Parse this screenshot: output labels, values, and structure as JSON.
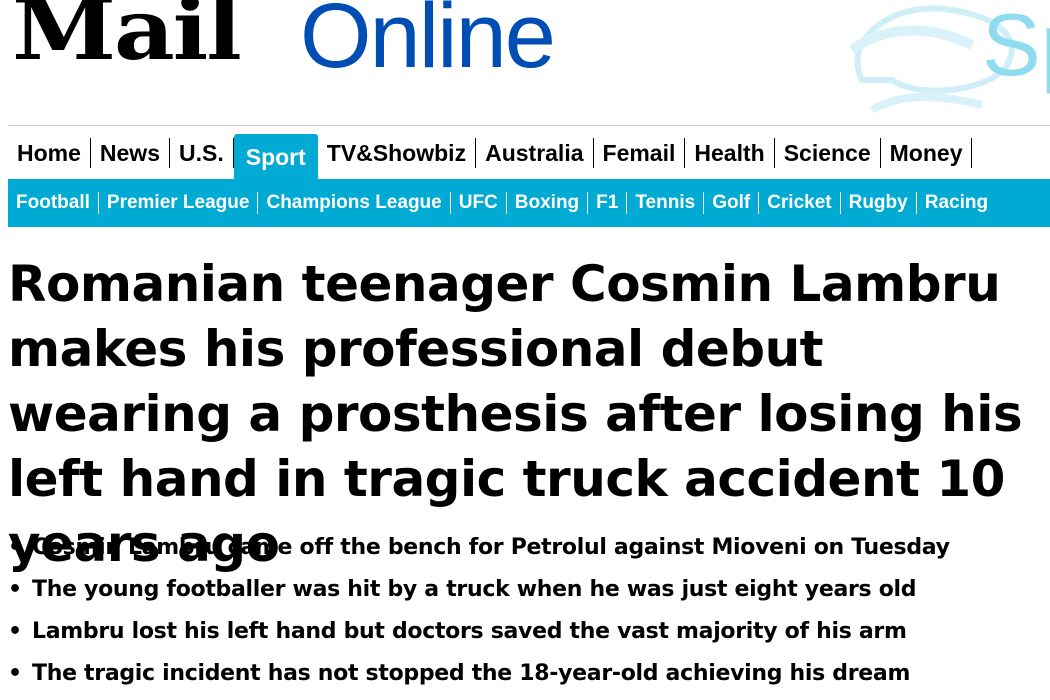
{
  "masthead": {
    "logo_mail": "Mail",
    "logo_online": "Online",
    "promo_text": "Sp"
  },
  "nav": {
    "primary": [
      "Home",
      "News",
      "U.S.",
      "Sport",
      "TV&Showbiz",
      "Australia",
      "Femail",
      "Health",
      "Science",
      "Money"
    ],
    "active": "Sport",
    "secondary": [
      "Football",
      "Premier League",
      "Champions League",
      "UFC",
      "Boxing",
      "F1",
      "Tennis",
      "Golf",
      "Cricket",
      "Rugby",
      "Racing"
    ]
  },
  "article": {
    "headline": "Romanian teenager Cosmin Lambru makes his professional debut wearing a prosthesis after losing his left hand in tragic truck accident 10 years ago",
    "bullets": [
      "Cosmin Lambru came off the bench for Petrolul against Mioveni on Tuesday",
      "The young footballer was hit by a truck when he was just eight years old",
      "Lambru lost his left hand but doctors saved the vast majority of his arm",
      "The tragic incident has not stopped the 18-year-old achieving his dream"
    ],
    "bullet_glyph": "•"
  },
  "colors": {
    "brand_blue": "#004db3",
    "sport_accent": "#00aad2"
  }
}
